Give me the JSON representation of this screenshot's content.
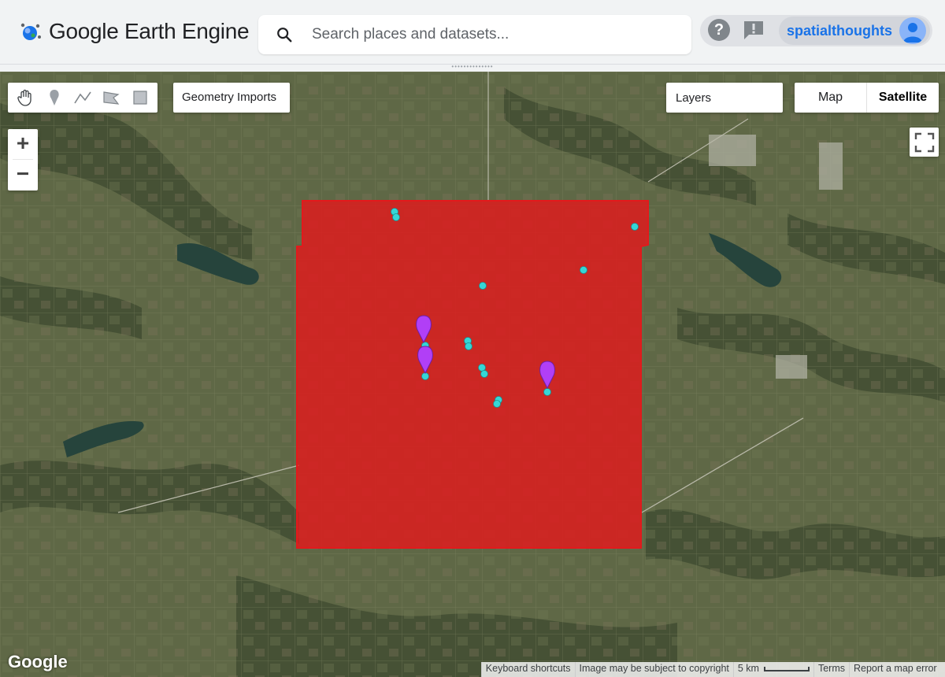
{
  "app": {
    "title": "Google Earth Engine"
  },
  "search": {
    "placeholder": "Search places and datasets..."
  },
  "user": {
    "name": "spatialthoughts"
  },
  "icons": {
    "logo": "earth-engine-logo-icon",
    "search": "search-icon",
    "help": "help-icon",
    "feedback": "feedback-icon",
    "avatar": "avatar-icon",
    "draw_tools": [
      "hand-icon",
      "marker-icon",
      "line-icon",
      "polygon-icon",
      "rectangle-icon"
    ],
    "fullscreen": "fullscreen-icon"
  },
  "help_glyph": "?",
  "toolbar": {
    "geometry_imports": "Geometry Imports",
    "layers": "Layers",
    "map_type": {
      "map": "Map",
      "satellite": "Satellite",
      "selected": "Satellite"
    }
  },
  "zoom": {
    "in": "+",
    "out": "−"
  },
  "map": {
    "attribution_logo": "Google",
    "footer": {
      "shortcuts": "Keyboard shortcuts",
      "copyright": "Image may be subject to copyright",
      "scale": "5 km",
      "terms": "Terms",
      "report": "Report a map error"
    },
    "overlay": {
      "fill_color": "#e3191c",
      "opacity": 0.8
    },
    "point_color": "#35d6d6",
    "marker_color": "#b13ff6"
  }
}
